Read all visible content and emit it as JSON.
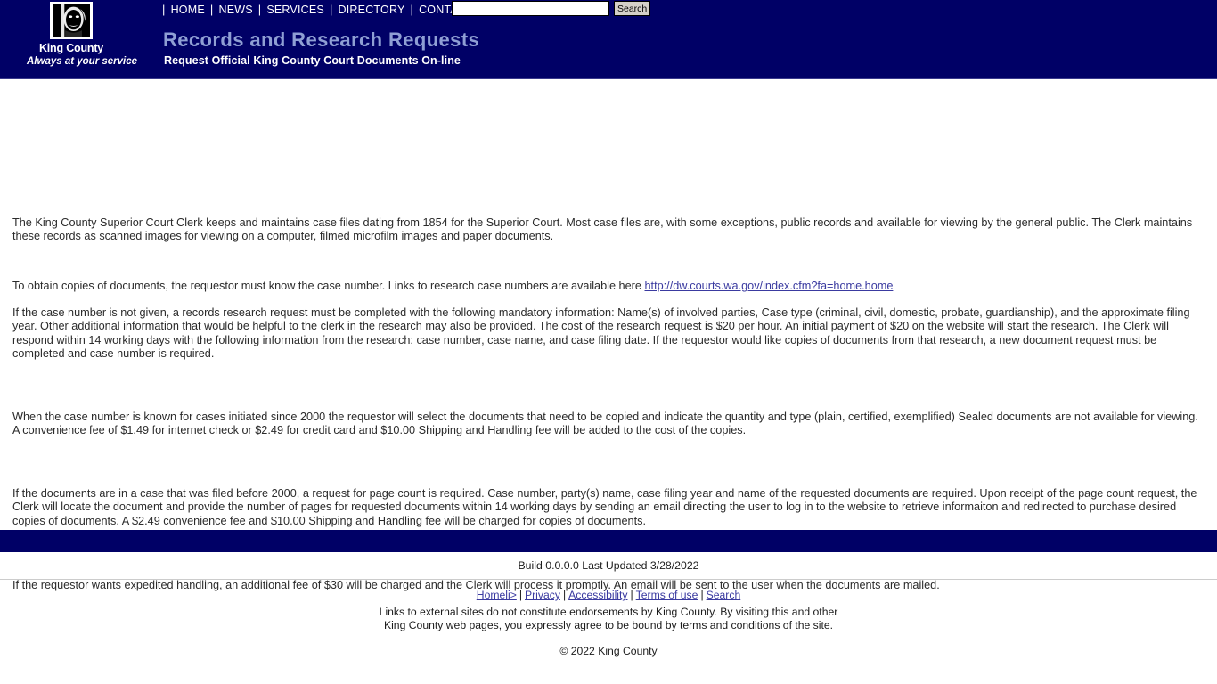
{
  "header": {
    "logo": {
      "icon": "king-county-mlk-logo",
      "name": "King County",
      "tagline": "Always at your service"
    },
    "nav": {
      "separator": "|",
      "items": [
        {
          "label": "HOME"
        },
        {
          "label": "NEWS"
        },
        {
          "label": "SERVICES"
        },
        {
          "label": "DIRECTORY"
        },
        {
          "label": "CONTACT"
        }
      ]
    },
    "search": {
      "value": "",
      "placeholder": "",
      "button_label": "Search",
      "icon": "search-icon"
    },
    "title": "Records and Research Requests",
    "subtitle": "Request Official King County Court Documents On-line",
    "background_color": "#000066",
    "title_color": "#8f9fd4"
  },
  "main": {
    "paragraphs": {
      "p1": "The King County Superior Court Clerk keeps and maintains case files dating from 1854 for the Superior Court. Most case files are, with some exceptions, public records and available for viewing by the general public. The Clerk maintains these records as scanned images for viewing on a computer, filmed microfilm images and paper documents.",
      "p2_prefix": "To obtain copies of documents, the requestor must know the case number. Links to research case numbers are available here ",
      "p2_link_text": "http://dw.courts.wa.gov/index.cfm?fa=home.home",
      "p3": "If the case number is not given, a records research request must be completed with the following mandatory information: Name(s) of involved parties, Case type (criminal, civil, domestic, probate, guardianship), and the approximate filing year. Other additional information that would be helpful to the clerk in the research may also be provided. The cost of the research request is $20 per hour. An initial payment of $20 on the website will start the research. The Clerk will respond within 14 working days with the following information from the research: case number, case name, and case filing date. If the requestor would like copies of documents from that research, a new document request must be completed and case number is required.",
      "p4": "When the case number is known for cases initiated since 2000 the requestor will select the documents that need to be copied and indicate the quantity and type (plain, certified, exemplified) Sealed documents are not available for viewing. A convenience fee of $1.49 for internet check or $2.49 for credit card and $10.00 Shipping and Handling fee will be added to the cost of the copies.",
      "p5": "If the documents are in a case that was filed before 2000, a request for page count is required. Case number, party(s) name, case filing year and name of the requested documents are required. Upon receipt of the page count request, the Clerk will locate the document and provide the number of pages for requested documents within 14 working days by sending an email directing the user to log in to the website to retrieve informaiton and redirected to purchase desired copies of documents. A $2.49 convenience fee and $10.00 Shipping and Handling fee will be charged for copies of documents.",
      "p6": "If the requestor wants expedited handling, an additional fee of $30 will be charged and the Clerk will process it promptly. An email will be sent to the user when the documents are mailed."
    }
  },
  "footer": {
    "build_text": "Build 0.0.0.0 Last Updated 3/28/2022",
    "separator": "|",
    "links": [
      {
        "label": "Homeli>"
      },
      {
        "label": "Privacy"
      },
      {
        "label": "Accessibility"
      },
      {
        "label": "Terms of use"
      },
      {
        "label": "Search"
      }
    ],
    "disclaimer_line1": "Links to external sites do not constitute endorsements by King County. By visiting this and other",
    "disclaimer_line2": "King County web pages, you expressly agree to be bound by terms and conditions of the site.",
    "copyright": "© 2022 King County"
  }
}
